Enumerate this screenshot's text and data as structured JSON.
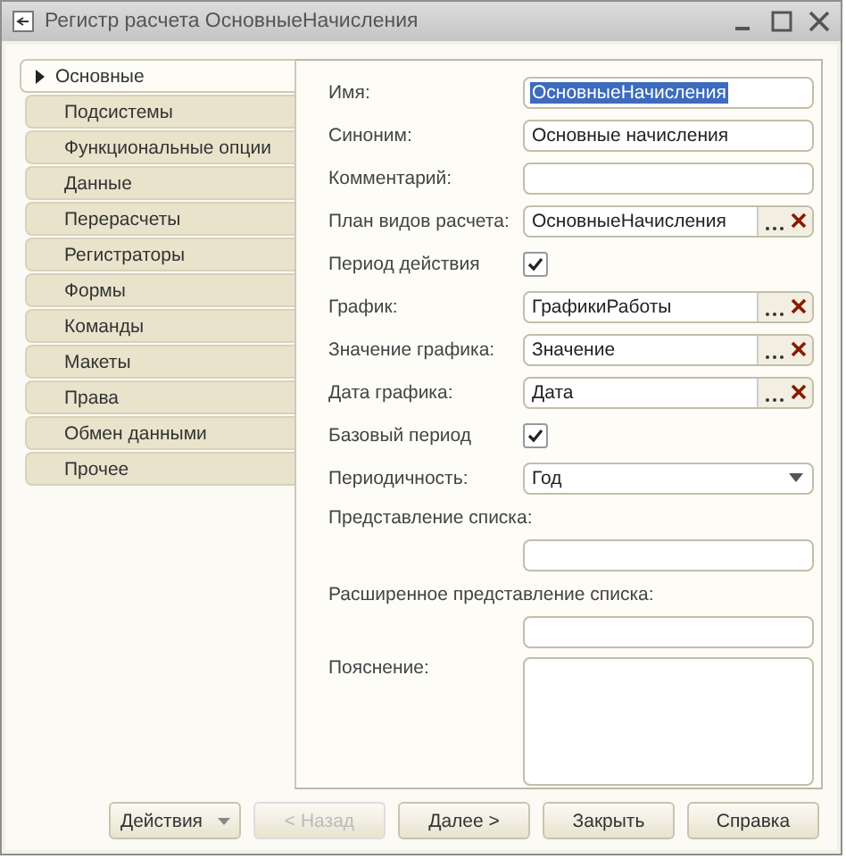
{
  "window": {
    "title": "Регистр расчета ОсновныеНачисления"
  },
  "tabs": [
    {
      "label": "Основные",
      "selected": true
    },
    {
      "label": "Подсистемы",
      "selected": false
    },
    {
      "label": "Функциональные опции",
      "selected": false
    },
    {
      "label": "Данные",
      "selected": false
    },
    {
      "label": "Перерасчеты",
      "selected": false
    },
    {
      "label": "Регистраторы",
      "selected": false
    },
    {
      "label": "Формы",
      "selected": false
    },
    {
      "label": "Команды",
      "selected": false
    },
    {
      "label": "Макеты",
      "selected": false
    },
    {
      "label": "Права",
      "selected": false
    },
    {
      "label": "Обмен данными",
      "selected": false
    },
    {
      "label": "Прочее",
      "selected": false
    }
  ],
  "fields": [
    {
      "kind": "text",
      "label": "Имя:",
      "value": "ОсновныеНачисления",
      "selected": true
    },
    {
      "kind": "text",
      "label": "Синоним:",
      "value": "Основные начисления"
    },
    {
      "kind": "text",
      "label": "Комментарий:"
    },
    {
      "kind": "choice",
      "label": "План видов расчета:",
      "value": "ОсновныеНачисления"
    },
    {
      "kind": "check",
      "label": "Период действия",
      "checked": true
    },
    {
      "kind": "choice",
      "label": "График:",
      "value": "ГрафикиРаботы"
    },
    {
      "kind": "choice",
      "label": "Значение графика:",
      "value": "Значение"
    },
    {
      "kind": "choice",
      "label": "Дата графика:",
      "value": "Дата"
    },
    {
      "kind": "check",
      "label": "Базовый период",
      "checked": true
    },
    {
      "kind": "dropdown",
      "label": "Периодичность:",
      "value": "Год"
    },
    {
      "kind": "wide",
      "label": "Представление списка:"
    },
    {
      "kind": "wide",
      "label": "Расширенное представление списка:"
    },
    {
      "kind": "memo",
      "label": "Пояснение:"
    }
  ],
  "buttons": [
    {
      "label": "Действия",
      "kind": "menu",
      "disabled": false
    },
    {
      "label": "< Назад",
      "kind": "plain",
      "disabled": true
    },
    {
      "label": "Далее >",
      "kind": "plain",
      "disabled": false
    },
    {
      "label": "Закрыть",
      "kind": "plain",
      "disabled": false
    },
    {
      "label": "Справка",
      "kind": "plain",
      "disabled": false
    }
  ]
}
